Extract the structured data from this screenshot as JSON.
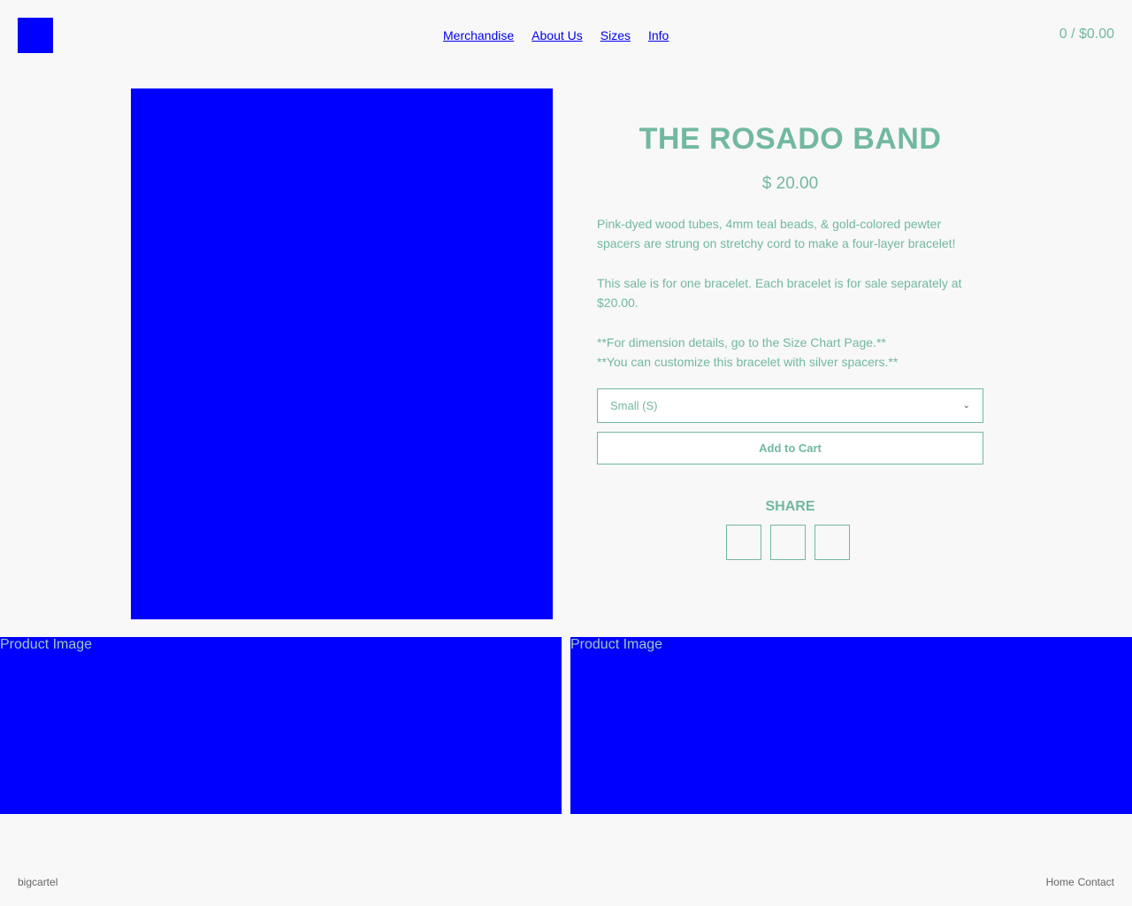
{
  "header": {
    "logo_icon": "store-logo",
    "nav": [
      "Merchandise",
      "About Us",
      "Sizes",
      "Info"
    ],
    "cart": "0 / $0.00"
  },
  "product": {
    "title": "THE ROSADO BAND",
    "price": "$ 20.00",
    "description": [
      "Pink-dyed wood tubes, 4mm teal beads, & gold-colored pewter spacers are strung on stretchy cord to make a four-layer bracelet!",
      "This sale is for one bracelet. Each bracelet is for sale separately at $20.00.",
      "**For dimension details, go to the Size Chart Page.**\n**You can customize this bracelet with silver spacers.**"
    ],
    "size_selected": "Small (S)",
    "add_to_cart": "Add to Cart",
    "share_label": "SHARE"
  },
  "gallery": {
    "alt1": "Product Image",
    "alt2": "Product Image"
  },
  "footer": {
    "left": "bigcartel",
    "links": [
      "Home",
      "Contact"
    ]
  },
  "colors": {
    "accent": "#72b8a0",
    "placeholder": "#0000ff",
    "background": "#f8f8f8"
  }
}
